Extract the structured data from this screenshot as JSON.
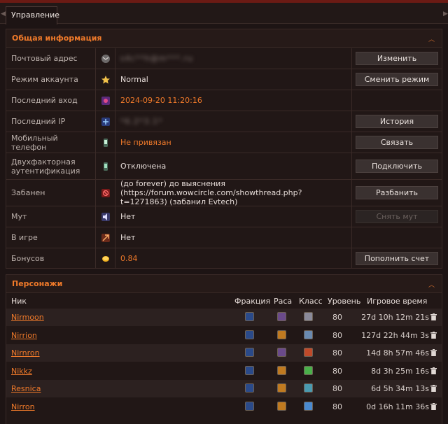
{
  "tabs": {
    "manage": "Управление"
  },
  "general": {
    "title": "Общая информация",
    "rows": [
      {
        "label": "Почтовый адрес",
        "value": "s4c**h@m***.ru",
        "icon": "mail-icon",
        "action": "Изменить",
        "blurred": true
      },
      {
        "label": "Режим аккаунта",
        "value": "Normal",
        "icon": "star-icon",
        "action": "Сменить режим"
      },
      {
        "label": "Последний вход",
        "value": "2024-09-20 11:20:16",
        "icon": "login-icon",
        "action": ""
      },
      {
        "label": "Последний IP",
        "value": "*6.2*3.1*",
        "icon": "ip-icon",
        "action": "История",
        "blurred": true
      },
      {
        "label": "Мобильный телефон",
        "value": "Не привязан",
        "icon": "phone-icon",
        "action": "Связать"
      },
      {
        "label": "Двухфакторная аутентификация",
        "value": "Отключена",
        "icon": "2fa-icon",
        "action": "Подключить"
      },
      {
        "label": "Забанен",
        "value": "(до forever) до выяснения (https://forum.wowcircle.com/showthread.php?t=1271863) (забанил Evtech)",
        "icon": "ban-icon",
        "action": "Разбанить"
      },
      {
        "label": "Мут",
        "value": "Нет",
        "icon": "mute-icon",
        "action": "Снять мут"
      },
      {
        "label": "В игре",
        "value": "Нет",
        "icon": "ingame-icon",
        "action": ""
      },
      {
        "label": "Бонусов",
        "value": "0.84",
        "icon": "coin-icon",
        "action": "Пополнить счет"
      }
    ]
  },
  "characters": {
    "title": "Персонажи",
    "columns": {
      "name": "Ник",
      "faction": "Фракция",
      "race": "Раса",
      "class": "Класс",
      "level": "Уровень",
      "time": "Игровое время"
    },
    "rows": [
      {
        "name": "Nirmoon",
        "level": "80",
        "time": "27d 10h 12m 21s"
      },
      {
        "name": "Nirrion",
        "level": "80",
        "time": "127d 22h 44m 3s"
      },
      {
        "name": "Nirnron",
        "level": "80",
        "time": "14d 8h 57m 46s"
      },
      {
        "name": "Nikkz",
        "level": "80",
        "time": "8d 3h 25m 16s"
      },
      {
        "name": "Resnica",
        "level": "80",
        "time": "6d 5h 34m 13s"
      },
      {
        "name": "Nirron",
        "level": "80",
        "time": "0d 16h 11m 36s"
      }
    ]
  }
}
